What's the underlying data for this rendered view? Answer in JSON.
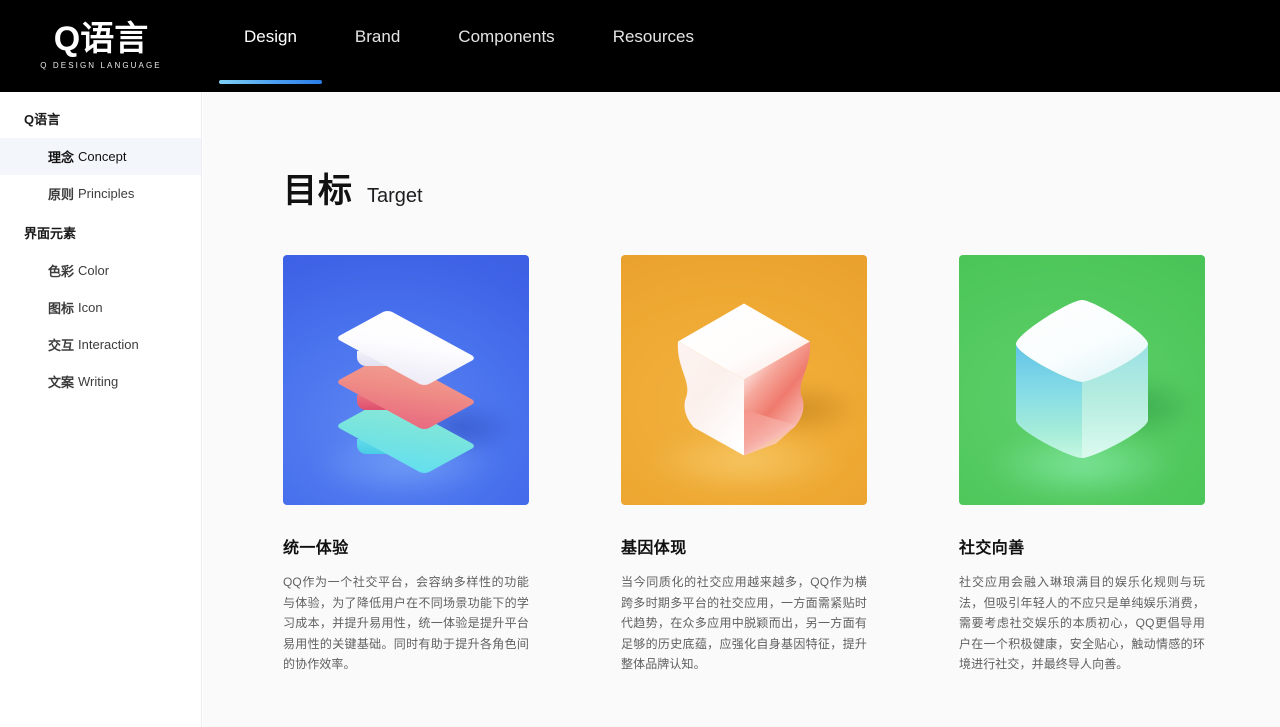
{
  "brand": {
    "logo_text": "Q语言",
    "logo_tagline": "Q DESIGN LANGUAGE"
  },
  "topnav": {
    "items": [
      {
        "label": "Design",
        "active": true
      },
      {
        "label": "Brand",
        "active": false
      },
      {
        "label": "Components",
        "active": false
      },
      {
        "label": "Resources",
        "active": false
      }
    ],
    "active_indicator_color": "#3f8fe8"
  },
  "sidebar": {
    "groups": [
      {
        "title": "Q语言",
        "items": [
          {
            "zh": "理念",
            "en": "Concept",
            "active": true
          },
          {
            "zh": "原则",
            "en": "Principles",
            "active": false
          }
        ]
      },
      {
        "title": "界面元素",
        "items": [
          {
            "zh": "色彩",
            "en": "Color",
            "active": false
          },
          {
            "zh": "图标",
            "en": "Icon",
            "active": false
          },
          {
            "zh": "交互",
            "en": "Interaction",
            "active": false
          },
          {
            "zh": "文案",
            "en": "Writing",
            "active": false
          }
        ]
      }
    ],
    "active_background": "#f3f6fb"
  },
  "main": {
    "title_zh": "目标",
    "title_en": "Target",
    "cards": [
      {
        "title": "统一体验",
        "body": "QQ作为一个社交平台，会容纳多样性的功能与体验，为了降低用户在不同场景功能下的学习成本，并提升易用性，统一体验是提升平台易用性的关键基础。同时有助于提升各角色间的协作效率。",
        "media_name": "stacked-layers-illustration",
        "media_background": "#4a73ee",
        "media_palette": [
          "#ffffff",
          "#ef8d86",
          "#79e4dd"
        ]
      },
      {
        "title": "基因体现",
        "body": "当今同质化的社交应用越来越多，QQ作为横跨多时期多平台的社交应用，一方面需紧贴时代趋势，在众多应用中脱颖而出，另一方面有足够的历史底蕴，应强化自身基因特征，提升整体品牌认知。",
        "media_name": "twisted-cube-illustration",
        "media_background": "#eea933",
        "media_palette": [
          "#ffffff",
          "#f0766a"
        ]
      },
      {
        "title": "社交向善",
        "body": "社交应用会融入琳琅满目的娱乐化规则与玩法，但吸引年轻人的不应只是单纯娱乐消费，需要考虑社交娱乐的本质初心，QQ更倡导用户在一个积极健康，安全贴心，触动情感的环境进行社交，并最终导人向善。",
        "media_name": "rounded-cube-illustration",
        "media_background": "#52c95e",
        "media_palette": [
          "#ffffff",
          "#5fd5e8"
        ]
      }
    ]
  }
}
